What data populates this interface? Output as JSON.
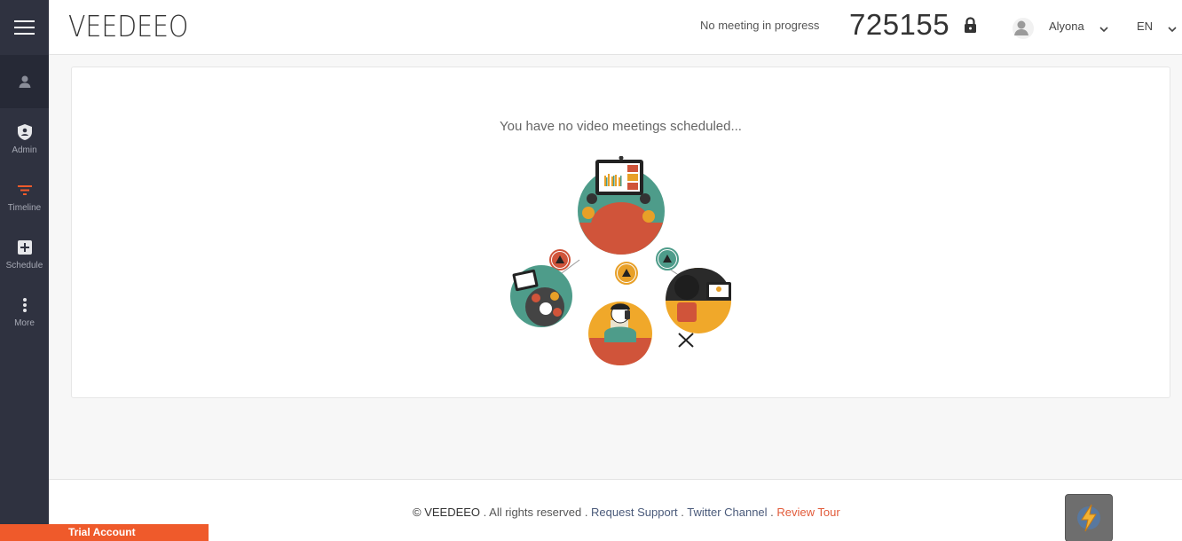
{
  "app": {
    "logo": "VEEDEEO"
  },
  "header": {
    "status": "No meeting in progress",
    "meeting_id": "725155",
    "user_name": "Alyona",
    "language": "EN"
  },
  "sidebar": {
    "items": [
      {
        "label": "Admin",
        "icon": "shield-icon"
      },
      {
        "label": "Timeline",
        "icon": "filter-icon"
      },
      {
        "label": "Schedule",
        "icon": "plus-square-icon"
      },
      {
        "label": "More",
        "icon": "more-vertical-icon"
      }
    ]
  },
  "main": {
    "empty_message": "You have no video meetings scheduled..."
  },
  "footer": {
    "copyright": "© VEEDEEO",
    "rights": " . All rights reserved . ",
    "support": "Request Support",
    "sep1": " . ",
    "twitter": "Twitter Channel",
    "sep2": " . ",
    "review": "Review Tour"
  },
  "trial_badge": "Trial Account",
  "colors": {
    "sidebar_bg": "#2f3240",
    "accent": "#ef5a2b",
    "link": "#4a5a7a"
  }
}
